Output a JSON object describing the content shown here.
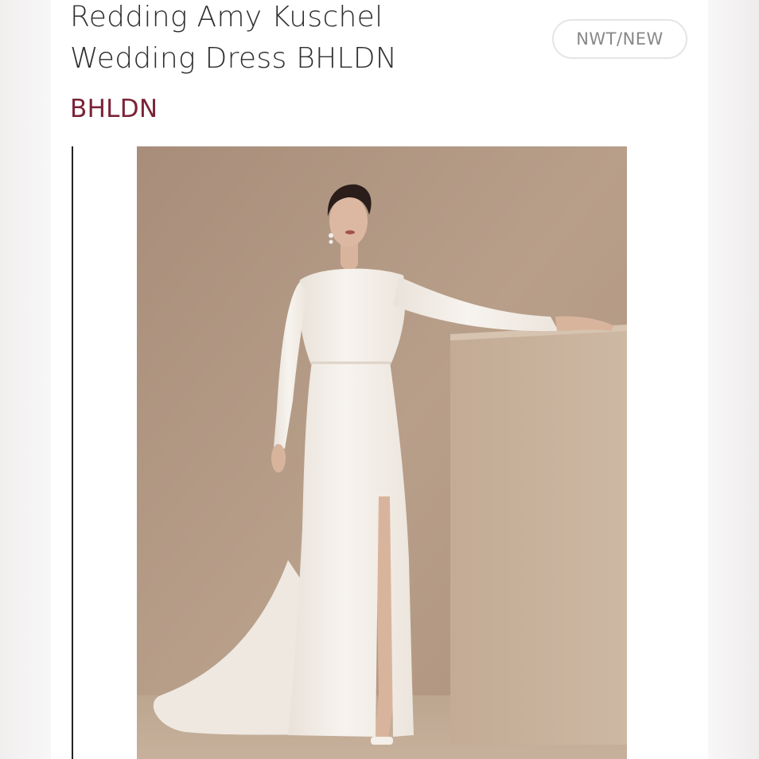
{
  "listing": {
    "title": "Redding Amy Kuschel\nWedding Dress BHLDN",
    "condition": "NWT/NEW",
    "brand": "BHLDN"
  },
  "photo": {
    "subject": "model in long-sleeve white wedding gown with train and front slit, arm resting on beige block",
    "background_color": "#b59b86",
    "block_color": "#c8b29c",
    "dress_color": "#f4efe9"
  },
  "colors": {
    "brand_accent": "#7b2437",
    "title_text": "#2f2f2f",
    "badge_text": "#888888",
    "badge_border": "#e6e4e4"
  }
}
